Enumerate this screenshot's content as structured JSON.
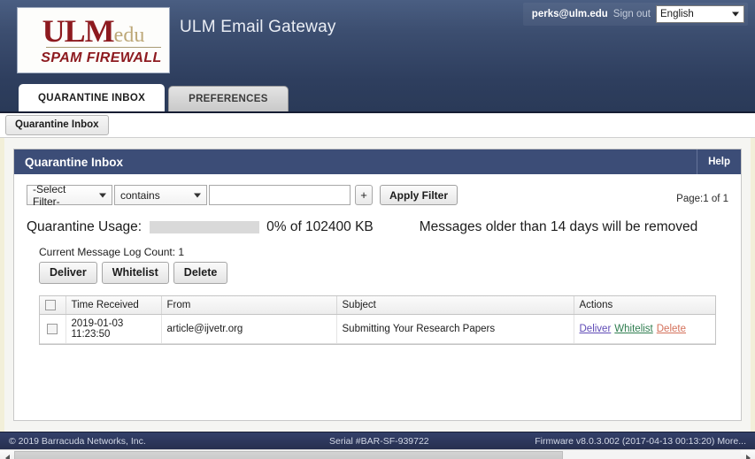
{
  "header": {
    "logo": {
      "primary": "ULM",
      "suffix": "edu",
      "tagline": "SPAM FIREWALL"
    },
    "app_title": "ULM Email Gateway",
    "account_email": "perks@ulm.edu",
    "sign_out_label": "Sign out",
    "language": "English"
  },
  "tabs": [
    {
      "label": "QUARANTINE INBOX",
      "active": true
    },
    {
      "label": "PREFERENCES",
      "active": false
    }
  ],
  "breadcrumb": {
    "label": "Quarantine Inbox"
  },
  "panel": {
    "title": "Quarantine Inbox",
    "help_label": "Help"
  },
  "filter": {
    "field_select": "-Select Filter-",
    "operator_select": "contains",
    "value": "",
    "value_placeholder": "",
    "add_label": "+",
    "apply_label": "Apply Filter"
  },
  "pagination": {
    "text": "Page:1 of 1"
  },
  "usage": {
    "label": "Quarantine Usage:",
    "percent": 0,
    "percent_text": "0% of 102400 KB",
    "retention_note": "Messages older than 14 days will be removed"
  },
  "message_log": {
    "count_label": "Current Message Log Count: 1",
    "buttons": [
      {
        "label": "Deliver"
      },
      {
        "label": "Whitelist"
      },
      {
        "label": "Delete"
      }
    ],
    "columns": [
      "",
      "Time Received",
      "From",
      "Subject",
      "Actions"
    ],
    "rows": [
      {
        "checked": false,
        "time_received": "2019-01-03 11:23:50",
        "from": "article@ijvetr.org",
        "subject": "Submitting Your Research Papers",
        "actions": [
          {
            "label": "Deliver",
            "color": "#5f4bb6"
          },
          {
            "label": "Whitelist",
            "color": "#2e7d4f"
          },
          {
            "label": "Delete",
            "color": "#d4705a"
          }
        ]
      }
    ]
  },
  "footer": {
    "copyright": "© 2019 Barracuda Networks, Inc.",
    "serial": "Serial #BAR-SF-939722",
    "firmware": "Firmware v8.0.3.002 (2017-04-13 00:13:20)",
    "more_label": "More..."
  }
}
